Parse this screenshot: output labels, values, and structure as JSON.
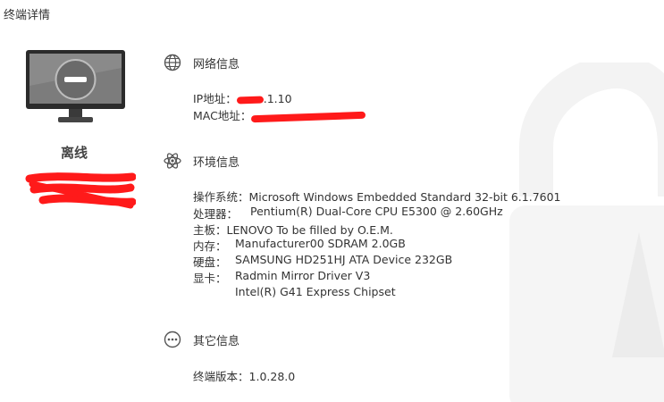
{
  "page": {
    "title": "终端详情"
  },
  "device": {
    "status": "离线"
  },
  "network": {
    "title": "网络信息",
    "ip_label": "IP地址：",
    "ip_suffix": ".1.10",
    "mac_label": "MAC地址："
  },
  "environment": {
    "title": "环境信息",
    "os_label": "操作系统：",
    "os_value": "Microsoft Windows Embedded Standard 32-bit 6.1.7601",
    "cpu_label": "处理器：",
    "cpu_value": "Pentium(R) Dual-Core CPU E5300 @ 2.60GHz",
    "board_label": "主板：",
    "board_value": "LENOVO To be filled by O.E.M.",
    "memory_label": "内存：",
    "memory_value": "Manufacturer00 SDRAM 2.0GB",
    "disk_label": "硬盘：",
    "disk_value": "SAMSUNG HD251HJ ATA Device 232GB",
    "gpu_label": "显卡：",
    "gpu_values": [
      "Radmin Mirror Driver V3",
      "Intel(R) G41 Express Chipset"
    ]
  },
  "other": {
    "title": "其它信息",
    "version_label": "终端版本：",
    "version_value": "1.0.28.0"
  },
  "colors": {
    "redaction": "#ff1a1a",
    "monitor_dark": "#2b2b2b",
    "screen_grey": "#7c7c7c"
  },
  "icons": {
    "network": "globe-icon",
    "environment": "atom-icon",
    "other": "more-dots-icon",
    "monitor": "monitor-offline-icon",
    "watermark": "lock-icon"
  }
}
